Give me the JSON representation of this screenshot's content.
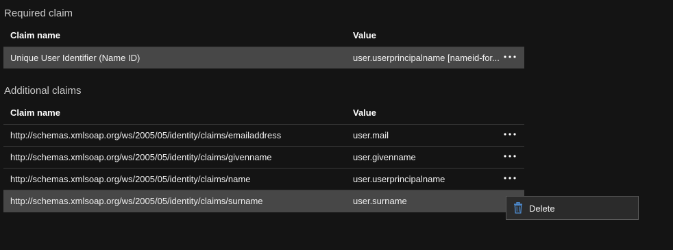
{
  "required": {
    "title": "Required claim",
    "headers": {
      "name": "Claim name",
      "value": "Value"
    },
    "rows": [
      {
        "name": "Unique User Identifier (Name ID)",
        "value": "user.userprincipalname [nameid-for..."
      }
    ]
  },
  "additional": {
    "title": "Additional claims",
    "headers": {
      "name": "Claim name",
      "value": "Value"
    },
    "rows": [
      {
        "name": "http://schemas.xmlsoap.org/ws/2005/05/identity/claims/emailaddress",
        "value": "user.mail"
      },
      {
        "name": "http://schemas.xmlsoap.org/ws/2005/05/identity/claims/givenname",
        "value": "user.givenname"
      },
      {
        "name": "http://schemas.xmlsoap.org/ws/2005/05/identity/claims/name",
        "value": "user.userprincipalname"
      },
      {
        "name": "http://schemas.xmlsoap.org/ws/2005/05/identity/claims/surname",
        "value": "user.surname"
      }
    ]
  },
  "context_menu": {
    "delete_label": "Delete",
    "delete_icon": "trash-icon"
  },
  "colors": {
    "background": "#141414",
    "selected_row": "#474747",
    "accent_icon": "#4f8fd6"
  }
}
